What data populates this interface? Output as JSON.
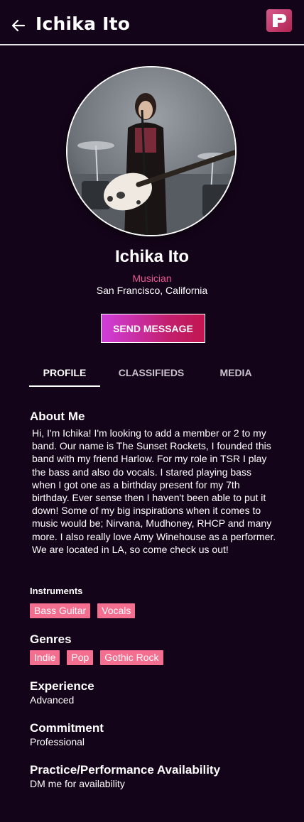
{
  "header": {
    "title": "Ichika Ito",
    "logo_letter": "P"
  },
  "profile": {
    "name": "Ichika Ito",
    "role": "Musician",
    "location": "San Francisco, California",
    "send_message_label": "SEND MESSAGE"
  },
  "tabs": [
    {
      "label": "PROFILE",
      "active": true
    },
    {
      "label": "CLASSIFIEDS",
      "active": false
    },
    {
      "label": "MEDIA",
      "active": false
    }
  ],
  "about": {
    "title": "About Me",
    "text": "Hi, I'm Ichika! I'm looking to add a member or 2 to my band. Our name is The Sunset Rockets, I founded this band with my friend Harlow. For my role in TSR I play the bass and also do vocals. I stared playing bass when I got one as a birthday present for my 7th birthday. Ever sense then I haven't been able to put it down! Some of my big inspirations when it comes to music would be; Nirvana, Mudhoney, RHCP and many more. I also really love Amy Winehouse as a performer. We are located in LA, so come check us out!"
  },
  "instruments": {
    "title": "Instruments",
    "items": [
      "Bass Guitar",
      "Vocals"
    ]
  },
  "genres": {
    "title": "Genres",
    "items": [
      "Indie",
      "Pop",
      "Gothic Rock"
    ]
  },
  "experience": {
    "title": "Experience",
    "value": "Advanced"
  },
  "commitment": {
    "title": "Commitment",
    "value": "Professional"
  },
  "availability": {
    "title": "Practice/Performance Availability",
    "value": "DM me for availability"
  },
  "colors": {
    "background": "#14041a",
    "accent_pink": "#e8588f",
    "tag_pink": "#f46e8f",
    "button_gradient_start": "#cf3fdb",
    "button_gradient_end": "#c21650"
  },
  "icons": {
    "back": "arrow-left-icon",
    "logo": "app-logo"
  }
}
